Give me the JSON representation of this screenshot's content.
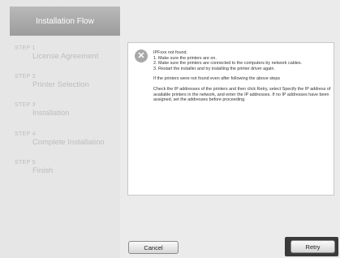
{
  "sidebar": {
    "title": "Installation Flow",
    "steps": [
      {
        "num": "STEP 1",
        "label": "License Agreement"
      },
      {
        "num": "STEP 2",
        "label": "Printer Selection"
      },
      {
        "num": "STEP 3",
        "label": "Installation"
      },
      {
        "num": "STEP 4",
        "label": "Complete Installation"
      },
      {
        "num": "STEP 5",
        "label": "Finish"
      }
    ]
  },
  "message": {
    "icon": "error-x-icon",
    "lines": [
      "IPFxxx not found.",
      "1. Make sure the printers are on.",
      "2. Make sure the printers are connected to the computers by network cables.",
      "3. Restart the installer and try installing the printer driver again.",
      "If the printers were not found even after following the above steps",
      "Check the IP addresses of the printers and then click Retry, select Specify the IP address of available printers in the network, and enter the IP addresses. If no IP addresses have been assigned, set the addresses before proceeding."
    ]
  },
  "buttons": {
    "cancel": "Cancel",
    "retry": "Retry"
  }
}
